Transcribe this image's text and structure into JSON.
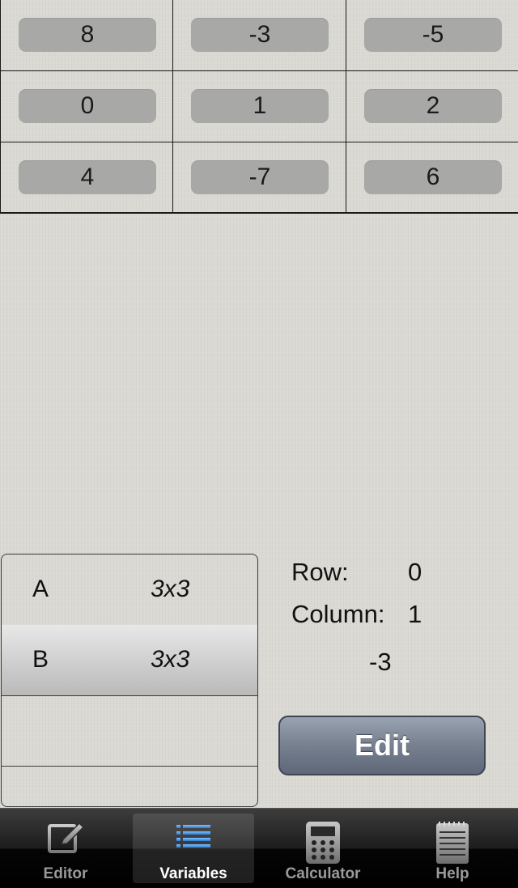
{
  "matrix": {
    "rows": [
      [
        "8",
        "-3",
        "-5"
      ],
      [
        "0",
        "1",
        "2"
      ],
      [
        "4",
        "-7",
        "6"
      ]
    ]
  },
  "variables": {
    "items": [
      {
        "name": "A",
        "size": "3x3"
      },
      {
        "name": "B",
        "size": "3x3"
      },
      {
        "name": "",
        "size": ""
      },
      {
        "name": "",
        "size": ""
      }
    ],
    "selected": 1
  },
  "info": {
    "row_label": "Row:",
    "row_value": "0",
    "column_label": "Column:",
    "column_value": "1",
    "cell_value": "-3",
    "edit_label": "Edit"
  },
  "tabs": [
    {
      "label": "Editor",
      "icon": "pencil-edit-icon"
    },
    {
      "label": "Variables",
      "icon": "list-icon",
      "active": true
    },
    {
      "label": "Calculator",
      "icon": "calculator-icon"
    },
    {
      "label": "Help",
      "icon": "notepad-icon"
    }
  ],
  "colors": {
    "tab_active_icon": "#3a8fe0",
    "edit_button": "#6e7888",
    "cell_fill": "#a8a8a6"
  }
}
